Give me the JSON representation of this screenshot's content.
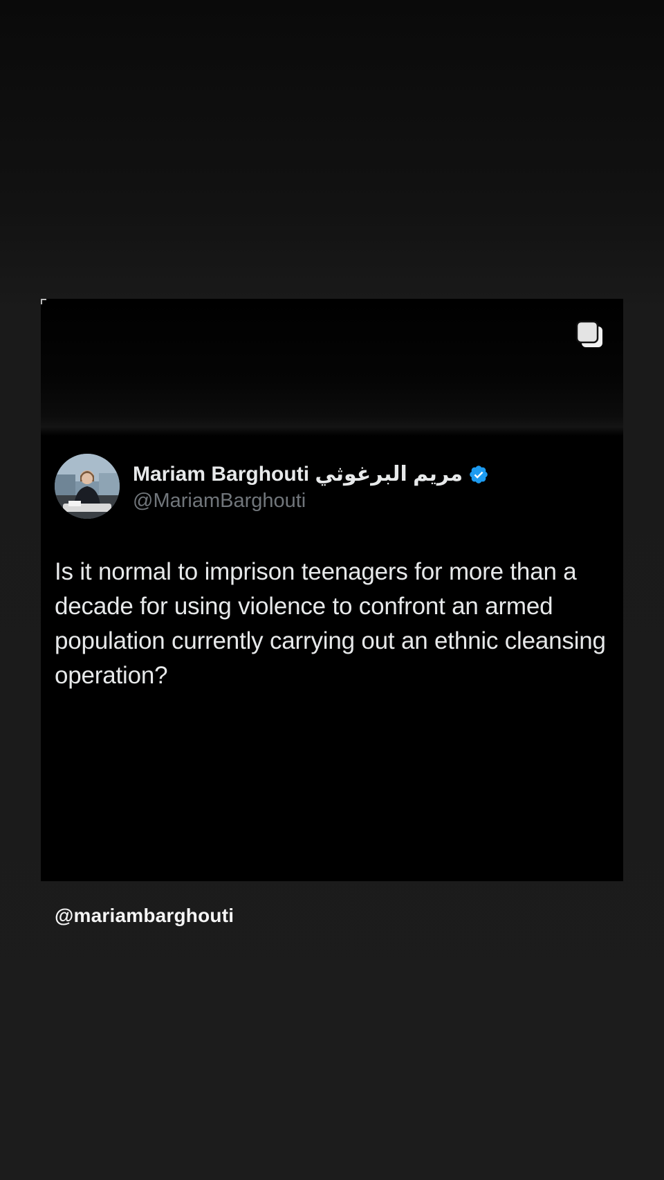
{
  "post": {
    "author": {
      "display_name": "Mariam Barghouti مريم البرغوثي",
      "handle": "@MariamBarghouti",
      "verified": true
    },
    "text": "Is it normal to imprison teenagers for more than a decade for using violence to confront an armed population currently carrying out an ethnic cleansing operation?",
    "media_type_icon": "multiple-images-icon"
  },
  "caption": {
    "username": "@mariambarghouti"
  },
  "colors": {
    "background": "#1c1c1c",
    "card": "#000000",
    "primary_text": "#e7e9ea",
    "secondary_text": "#71767b",
    "verified_blue": "#1d9bf0"
  }
}
